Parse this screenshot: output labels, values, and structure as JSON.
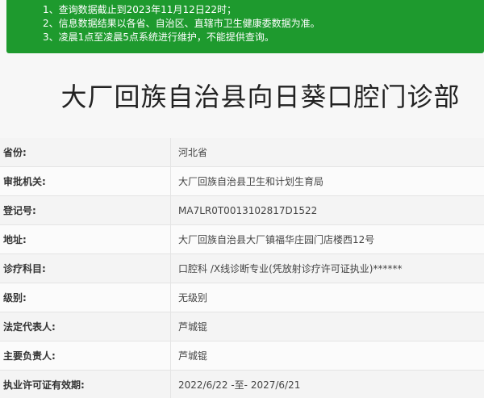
{
  "notice": {
    "lines": [
      "1、查询数据截止到2023年11月12日22时；",
      "2、信息数据结果以各省、自治区、直辖市卫生健康委数据为准。",
      "3、凌晨1点至凌晨5点系统进行维护，不能提供查询。"
    ]
  },
  "title": "大厂回族自治县向日葵口腔门诊部",
  "fields": [
    {
      "label": "省份:",
      "value": "河北省"
    },
    {
      "label": "审批机关:",
      "value": "大厂回族自治县卫生和计划生育局"
    },
    {
      "label": "登记号:",
      "value": "MA7LR0T0013102817D1522"
    },
    {
      "label": "地址:",
      "value": "大厂回族自治县大厂镇福华庄园门店楼西12号"
    },
    {
      "label": "诊疗科目:",
      "value": "口腔科 /X线诊断专业(凭放射诊疗许可证执业)******"
    },
    {
      "label": "级别:",
      "value": "无级别"
    },
    {
      "label": "法定代表人:",
      "value": "芦城锟"
    },
    {
      "label": "主要负责人:",
      "value": "芦城锟"
    },
    {
      "label": "执业许可证有效期:",
      "value": "2022/6/22 -至- 2027/6/21"
    }
  ]
}
